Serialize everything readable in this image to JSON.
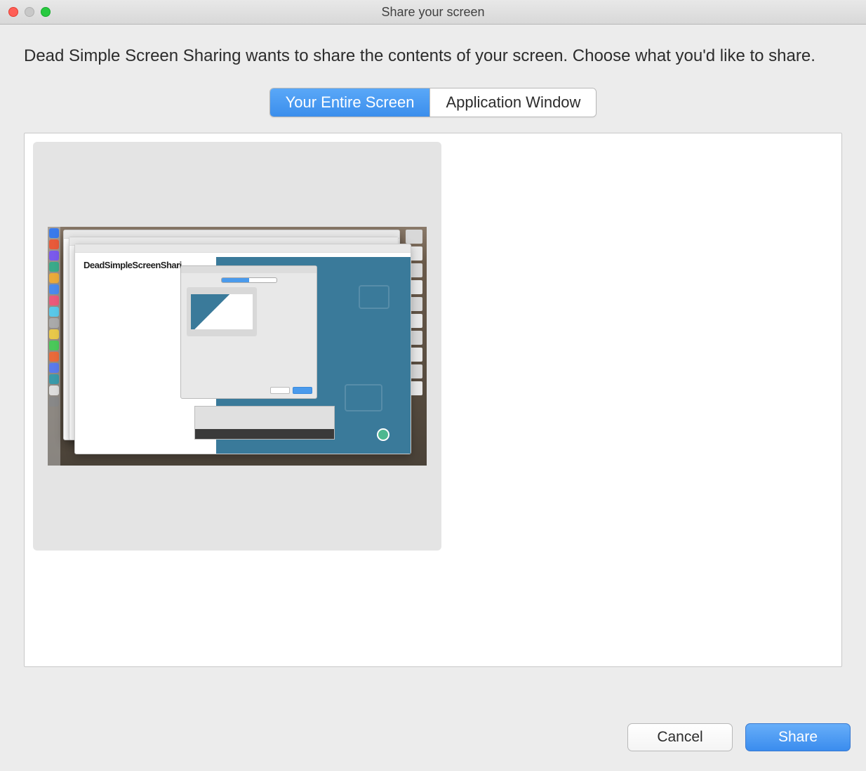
{
  "titlebar": {
    "title": "Share your screen"
  },
  "description": "Dead Simple Screen Sharing wants to share the contents of your screen. Choose what you'd like to share.",
  "tabs": {
    "entire_screen": "Your Entire Screen",
    "application_window": "Application Window"
  },
  "preview": {
    "app_title": "DeadSimpleScreenShari"
  },
  "buttons": {
    "cancel": "Cancel",
    "share": "Share"
  }
}
